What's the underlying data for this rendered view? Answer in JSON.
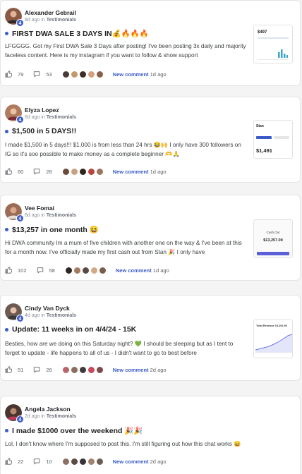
{
  "posts": [
    {
      "author": "Alexander Gebrail",
      "level": "4",
      "time": "8d ago",
      "in": "in",
      "category": "Testimonials",
      "title": "FIRST DWA SALE 3 DAYS IN💰🔥🔥🔥",
      "body": "LFGGGG. Got my First DWA Sale 3 Days after posting! I've been posting 3x daily and majority faceless content. Here is my instagram if you want to follow & show support",
      "likes": "79",
      "comments": "53",
      "new_comment": "New comment",
      "new_comment_ago": "1d ago",
      "thumb_text": "$497",
      "avatar_color": "#8a5a44",
      "mini_colors": [
        "#4a3b36",
        "#c29a6a",
        "#3d2c27",
        "#d4a07f",
        "#8b5e4a"
      ]
    },
    {
      "author": "Elyza Lopez",
      "level": "4",
      "time": "6d ago",
      "in": "in",
      "category": "Testimonials",
      "title": "$1,500 in 5 DAYS!!",
      "body": "I made $1,500 in 5 days!!! $1,000 is from less than 24 hrs 😂🙌 I only have 300 followers on IG so it's soo possible to make money as a complete beginner 🫶🙏",
      "likes": "60",
      "comments": "28",
      "new_comment": "New comment",
      "new_comment_ago": "1d ago",
      "thumb_text": "$1,491",
      "thumb_brand": "Stan",
      "avatar_color": "#b07a5e",
      "mini_colors": [
        "#6b4a3a",
        "#c8a27c",
        "#2f2420",
        "#b5473f",
        "#9c7560"
      ]
    },
    {
      "author": "Vee Fomai",
      "level": "4",
      "time": "6d ago",
      "in": "in",
      "category": "Testimonials",
      "title": "$13,257 in one month 😆",
      "body": "Hi DWA community Im a mum of five children with another one on the way & I've been at this for a month now. I've officially made my first cash out from Stan 🎉 I only have",
      "likes": "102",
      "comments": "58",
      "new_comment": "New comment",
      "new_comment_ago": "1d ago",
      "thumb_text": "$13,257.00",
      "thumb_label": "Cash Out",
      "avatar_color": "#9a6b55",
      "mini_colors": [
        "#2e2622",
        "#a37c60",
        "#5a4a44",
        "#d3a98a",
        "#7a5c4c"
      ]
    },
    {
      "author": "Cindy Van Dyck",
      "level": "4",
      "time": "4d ago",
      "in": "in",
      "category": "Testimonials",
      "title": "Update: 11 weeks in on 4/4/24 - 15K",
      "body": "Besties, how are we doing on this Saturday night? 💚 I should be sleeping but as I tent to forget to update - life happens to all of us - I didn't want to go to best before",
      "likes": "51",
      "comments": "26",
      "new_comment": "New comment",
      "new_comment_ago": "2d ago",
      "thumb_text": "Total Revenue 15,291.95",
      "avatar_color": "#6d5a50",
      "mini_colors": [
        "#b8646a",
        "#8a6e5e",
        "#3d3a3c",
        "#c94a5a",
        "#7d4c4a"
      ]
    },
    {
      "author": "Angela Jackson",
      "level": "4",
      "time": "2d ago",
      "in": "in",
      "category": "Testimonials",
      "title": "I made $1000 over the weekend 🎉🎉",
      "body": "Lol, I don't know where I'm supposed to post this. I'm still figuring out how this chat works 😄",
      "likes": "22",
      "comments": "10",
      "new_comment": "New comment",
      "new_comment_ago": "2d ago",
      "avatar_color": "#4a3630",
      "mini_colors": [
        "#8e6f63",
        "#5c4a42",
        "#3a3438",
        "#a0826e",
        "#6c5c54"
      ]
    }
  ]
}
